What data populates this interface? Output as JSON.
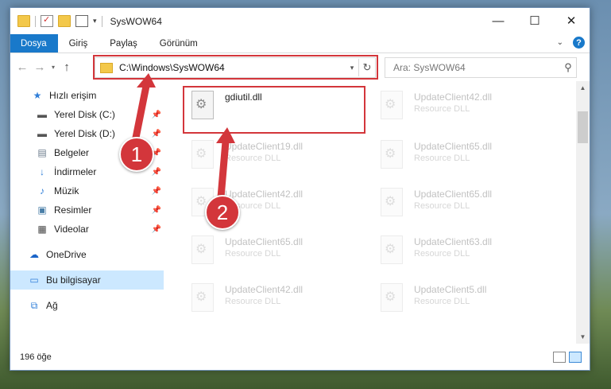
{
  "window": {
    "title": "SysWOW64",
    "controls": [
      "—",
      "☐",
      "✕"
    ]
  },
  "ribbon": {
    "tabs": [
      "Dosya",
      "Giriş",
      "Paylaş",
      "Görünüm"
    ]
  },
  "address": {
    "path": "C:\\Windows\\SysWOW64",
    "search_placeholder": "Ara: SysWOW64"
  },
  "sidebar": {
    "items": [
      {
        "label": "Hızlı erişim",
        "icon": "star-icon",
        "pinned": false,
        "selected": false
      },
      {
        "label": "Yerel Disk (C:)",
        "icon": "drive-icon",
        "pinned": true,
        "selected": false
      },
      {
        "label": "Yerel Disk (D:)",
        "icon": "drive-icon",
        "pinned": true,
        "selected": false
      },
      {
        "label": "Belgeler",
        "icon": "documents-icon",
        "pinned": true,
        "selected": false
      },
      {
        "label": "İndirmeler",
        "icon": "download-icon",
        "pinned": true,
        "selected": false
      },
      {
        "label": "Müzik",
        "icon": "music-icon",
        "pinned": true,
        "selected": false
      },
      {
        "label": "Resimler",
        "icon": "pictures-icon",
        "pinned": true,
        "selected": false
      },
      {
        "label": "Videolar",
        "icon": "videos-icon",
        "pinned": true,
        "selected": false
      },
      {
        "label": "OneDrive",
        "icon": "cloud-icon",
        "pinned": false,
        "selected": false
      },
      {
        "label": "Bu bilgisayar",
        "icon": "computer-icon",
        "pinned": false,
        "selected": true
      },
      {
        "label": "Ağ",
        "icon": "network-icon",
        "pinned": false,
        "selected": false
      }
    ]
  },
  "files": [
    {
      "name": "gdiutil.dll",
      "type": ""
    },
    {
      "name": "UpdateClient42.dll",
      "type": "Resource DLL"
    },
    {
      "name": "UpdateClient19.dll",
      "type": "Resource DLL"
    },
    {
      "name": "UpdateClient65.dll",
      "type": "Resource DLL"
    },
    {
      "name": "UpdateClient42.dll",
      "type": "Resource DLL"
    },
    {
      "name": "UpdateClient65.dll",
      "type": "Resource DLL"
    },
    {
      "name": "UpdateClient65.dll",
      "type": "Resource DLL"
    },
    {
      "name": "UpdateClient63.dll",
      "type": "Resource DLL"
    },
    {
      "name": "UpdateClient42.dll",
      "type": "Resource DLL"
    },
    {
      "name": "UpdateClient5.dll",
      "type": "Resource DLL"
    }
  ],
  "status": {
    "count": "196 öğe"
  },
  "annotations": {
    "step1": "1",
    "step2": "2",
    "color": "#d3363b"
  }
}
